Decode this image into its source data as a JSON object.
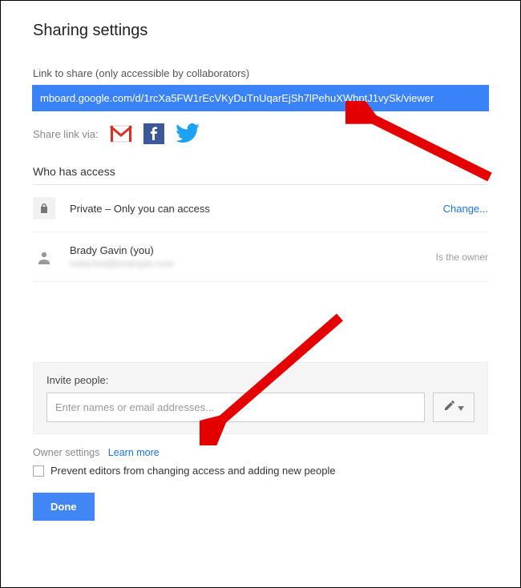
{
  "title": "Sharing settings",
  "link": {
    "label": "Link to share (only accessible by collaborators)",
    "url": "mboard.google.com/d/1rcXa5FW1rEcVKyDuTnUqarEjSh7lPehuXWbptJ1vySk/viewer"
  },
  "share_via": {
    "label": "Share link via:"
  },
  "access": {
    "heading": "Who has access",
    "privacy_text": "Private – Only you can access",
    "change_label": "Change...",
    "user_name": "Brady Gavin (you)",
    "user_sub": "redacted@example.com",
    "owner_label": "Is the owner"
  },
  "invite": {
    "heading": "Invite people:",
    "placeholder": "Enter names or email addresses..."
  },
  "owner_settings": {
    "label": "Owner settings",
    "learn_more": "Learn more",
    "checkbox_label": "Prevent editors from changing access and adding new people"
  },
  "done_label": "Done"
}
